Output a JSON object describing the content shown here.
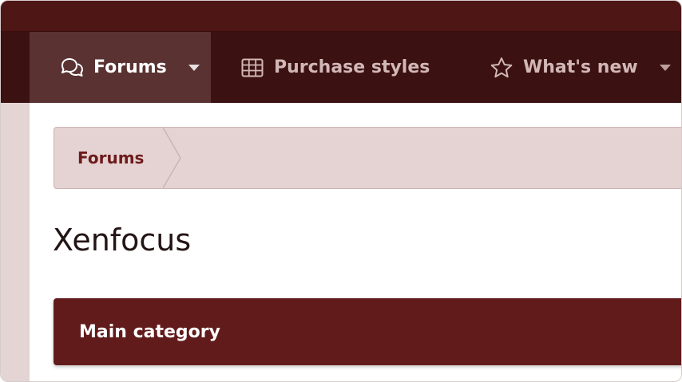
{
  "nav": {
    "tabs": [
      {
        "label": "Forums",
        "icon": "comments-icon",
        "selected": true,
        "has_dropdown": true
      },
      {
        "label": "Purchase styles",
        "icon": "grid-icon",
        "selected": false,
        "has_dropdown": false
      },
      {
        "label": "What's new",
        "icon": "star-icon",
        "selected": false,
        "has_dropdown": true
      }
    ]
  },
  "breadcrumb": {
    "items": [
      "Forums"
    ]
  },
  "page": {
    "title": "Xenfocus"
  },
  "categories": [
    {
      "title": "Main category"
    }
  ],
  "colors": {
    "top_strip": "#4f1616",
    "navbar": "#3c1111",
    "nav_selected": "#5a3232",
    "nav_text": "#d2b7b7",
    "breadcrumb_bg": "#e5d3d3",
    "breadcrumb_text": "#6e1b1b",
    "category_bg": "#621b1b"
  }
}
